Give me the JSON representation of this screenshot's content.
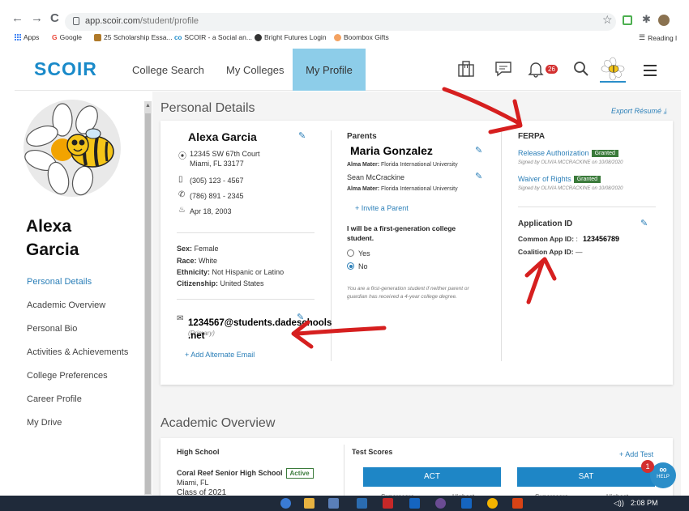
{
  "browser": {
    "back": "←",
    "forward": "→",
    "reload": "C",
    "url_host": "app.scoir.com",
    "url_path": "/student/profile",
    "star": "☆",
    "bookmarks": [
      {
        "label": "Apps",
        "color": "#4285f4"
      },
      {
        "label": "Google",
        "color": "#ea4335"
      },
      {
        "label": "25 Scholarship Essa...",
        "color": "#b07a2a"
      },
      {
        "label": "SCOIR - a Social an...",
        "color": "#1a8ac9"
      },
      {
        "label": "Bright Futures Login",
        "color": "#333333"
      },
      {
        "label": "Boombox Gifts",
        "color": "#f4a261"
      }
    ],
    "reading_list": "Reading l"
  },
  "header": {
    "logo": "SCOIR",
    "nav": [
      "College Search",
      "My Colleges",
      "My Profile"
    ],
    "notifications": "26",
    "accent": "#1a8ac9",
    "active_tab_color": "#8dcde9"
  },
  "sidebar": {
    "name_line1": "Alexa",
    "name_line2": "Garcia",
    "items": [
      "Personal Details",
      "Academic Overview",
      "Personal Bio",
      "Activities & Achievements",
      "College Preferences",
      "Career Profile",
      "My Drive"
    ]
  },
  "personal": {
    "section_title": "Personal Details",
    "export": "Export Résumé ⤓",
    "name": "Alexa Garcia",
    "address1": "12345 SW 67th Court",
    "address2": "Miami, FL 33177",
    "mobile": "(305) 123 - 4567",
    "phone": "(786) 891 - 2345",
    "birthday": "Apr 18, 2003",
    "sex_label": "Sex:",
    "sex": "Female",
    "race_label": "Race:",
    "race": "White",
    "ethnicity_label": "Ethnicity:",
    "ethnicity": "Not Hispanic or Latino",
    "citizenship_label": "Citizenship:",
    "citizenship": "United States",
    "email_line1": "1234567@students.dadeschools",
    "email_line2": ".net",
    "email_primary": "(Primary)",
    "add_email": "+ Add Alternate Email"
  },
  "parents": {
    "title": "Parents",
    "parent1": "Maria Gonzalez",
    "alma_label": "Alma Mater:",
    "parent1_alma": "Florida International University",
    "parent2": "Sean McCrackine",
    "parent2_alma": "Florida International University",
    "invite": "+ Invite a Parent",
    "first_gen_q1": "I will be a first-generation college",
    "first_gen_q2": "student.",
    "opt_yes": "Yes",
    "opt_no": "No",
    "note1": "You are a first-generation student if neither parent or",
    "note2": "guardian has received a 4-year college degree."
  },
  "ferpa": {
    "title": "FERPA",
    "release": "Release Authorization",
    "waiver": "Waiver of Rights",
    "granted": "Granted",
    "signed1": "Signed by OLIVIA MCCRACKINE on 10/08/2020",
    "signed2": "Signed by OLIVIA MCCRACKINE on 10/08/2020",
    "app_id_title": "Application ID",
    "common_label": "Common App ID:",
    "common_sep": ":",
    "common_value": "123456789",
    "coalition_label": "Coalition App ID:",
    "coalition_value": "—"
  },
  "academic": {
    "section_title": "Academic Overview",
    "hs_title": "High School",
    "school": "Coral Reef Senior High School",
    "active": "Active",
    "city": "Miami, FL",
    "class_of": "Class of 2021",
    "test_scores": "Test Scores",
    "add_test": "+ Add Test",
    "act": "ACT",
    "sat": "SAT",
    "act_sub1": "Superscore",
    "act_sub2": "Highest",
    "sat_sub1": "Superscore",
    "sat_sub2": "Highest"
  },
  "help": {
    "label": "HELP",
    "badge": "1"
  },
  "taskbar": {
    "time": "2:08 PM",
    "volume": "◁))"
  },
  "annotation_color": "#d61f1f"
}
